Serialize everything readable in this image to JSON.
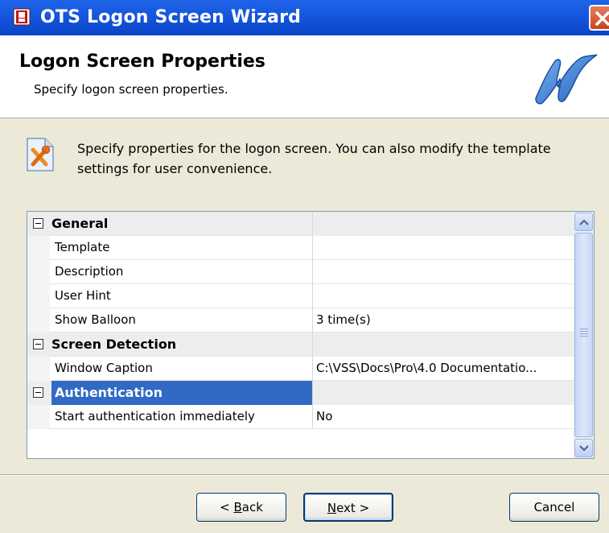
{
  "window": {
    "title": "OTS Logon Screen Wizard"
  },
  "header": {
    "title": "Logon Screen Properties",
    "subtitle": "Specify logon screen properties."
  },
  "info": {
    "text": "Specify properties for the logon screen. You can also modify the template settings for user convenience."
  },
  "grid": {
    "categories": [
      {
        "name": "General",
        "expanded": true,
        "selected": false,
        "properties": [
          {
            "name": "Template",
            "value": ""
          },
          {
            "name": "Description",
            "value": ""
          },
          {
            "name": "User Hint",
            "value": ""
          },
          {
            "name": "Show Balloon",
            "value": "3 time(s)"
          }
        ]
      },
      {
        "name": "Screen Detection",
        "expanded": true,
        "selected": false,
        "properties": [
          {
            "name": "Window Caption",
            "value": "C:\\VSS\\Docs\\Pro\\4.0 Documentatio..."
          }
        ]
      },
      {
        "name": "Authentication",
        "expanded": true,
        "selected": true,
        "properties": [
          {
            "name": "Start authentication immediately",
            "value": "No"
          }
        ]
      }
    ]
  },
  "buttons": {
    "back": {
      "prefix": "< ",
      "accel": "B",
      "rest": "ack"
    },
    "next": {
      "prefix": "",
      "accel": "N",
      "rest": "ext >"
    },
    "cancel": {
      "label": "Cancel"
    }
  },
  "colors": {
    "titlebar": "#0a44c5",
    "selection": "#316ac5",
    "dialog_bg": "#ece9d8"
  }
}
